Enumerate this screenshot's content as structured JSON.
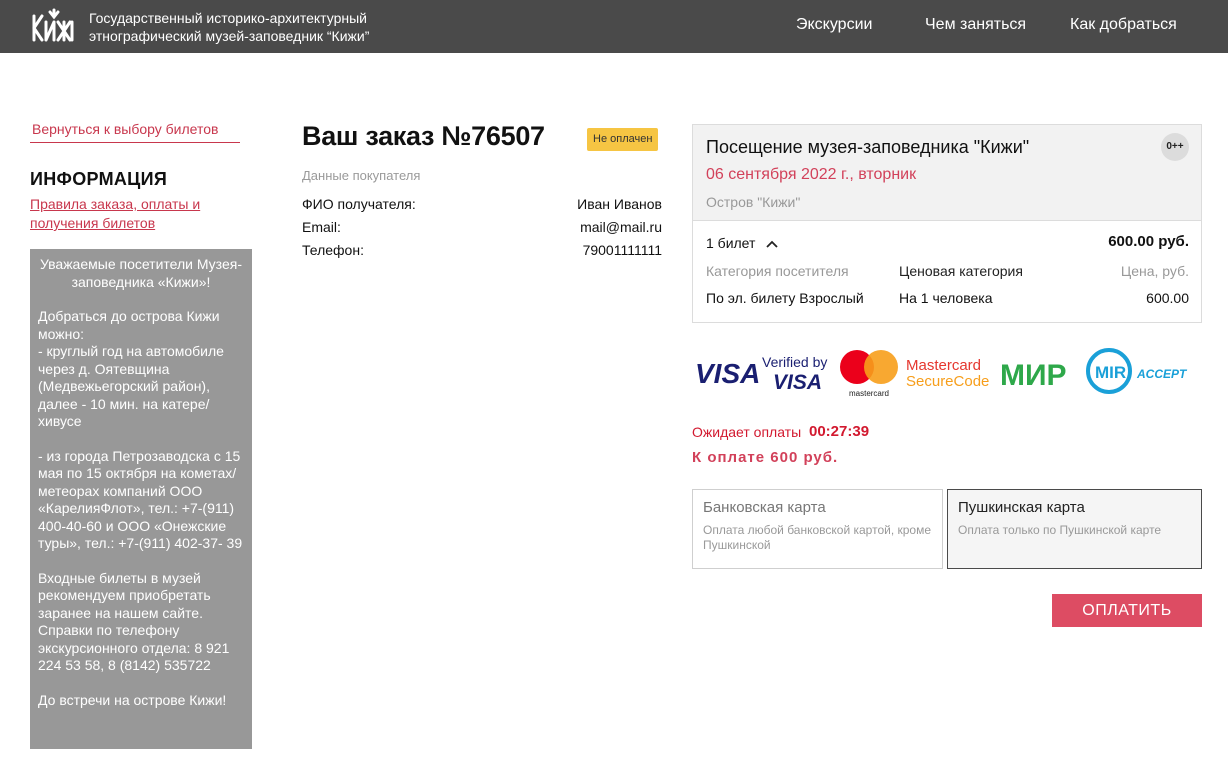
{
  "header": {
    "org_line1": "Государственный историко-архитектурный",
    "org_line2": "этнографический музей-заповедник “Кижи”",
    "nav": [
      "Экскурсии",
      "Чем заняться",
      "Как добраться"
    ]
  },
  "sidebar": {
    "back_link": "Вернуться к выбору билетов",
    "info_title": "ИНФОРМАЦИЯ",
    "rules_link": "Правила заказа, оплаты и получения билетов",
    "info_intro": "Уважаемые посетители Музея-заповедника «Кижи»!",
    "info_p1": "Добраться до острова Кижи можно:\n- круглый год на автомобиле через д. Оятевщина (Медвежьегорский район), далее - 10 мин. на катере/хивусе",
    "info_p2": "- из города Петрозаводска с 15 мая по 15 октября на кометах/метеорах компаний ООО «КарелияФлот», тел.: +7-(911) 400-40-60 и  ООО «Онежские туры», тел.: +7-(911) 402-37- 39",
    "info_p3": "Входные билеты в музей рекомендуем приобретать заранее на нашем сайте. Справки по телефону экскурсионного отдела: 8 921 224 53 58, 8 (8142) 535722",
    "info_p4": "До встречи на острове Кижи!"
  },
  "order": {
    "title": "Ваш заказ №76507",
    "status": "Не оплачен",
    "buyer_section": "Данные покупателя",
    "fields": [
      {
        "label": "ФИО получателя:",
        "value": "Иван Иванов"
      },
      {
        "label": "Email:",
        "value": "mail@mail.ru"
      },
      {
        "label": "Телефон:",
        "value": "79001111111"
      }
    ]
  },
  "summary": {
    "event": "Посещение музея-заповедника \"Кижи\"",
    "date": "06 сентября 2022 г., вторник",
    "place": "Остров \"Кижи\"",
    "age": "0++",
    "ticket_count": "1 билет",
    "ticket_total": "600.00 руб.",
    "headers": [
      "Категория посетителя",
      "Ценовая категория",
      "Цена, руб."
    ],
    "row": [
      "По эл. билету Взрослый",
      "На 1 человека",
      "600.00"
    ]
  },
  "payment_logos": {
    "visa": "VISA",
    "verified_line1": "Verified by",
    "verified_line2": "VISA",
    "mastercard": "mastercard",
    "securecode_line1": "Mastercard",
    "securecode_line2": "SecureCode",
    "mir": "МИР",
    "mir_accept": "ACCEPT"
  },
  "payment": {
    "await_label": "Ожидает оплаты",
    "timer": "00:27:39",
    "to_pay": "К оплате 600 руб.",
    "options": [
      {
        "title": "Банковская карта",
        "desc": "Оплата любой банковской картой, кроме Пушкинской"
      },
      {
        "title": "Пушкинская карта",
        "desc": "Оплата только по Пушкинской карте"
      }
    ],
    "pay_button": "ОПЛАТИТЬ"
  },
  "colors": {
    "header_bg": "#4a4a4a",
    "accent": "#dd4c63",
    "status_badge": "#f6c543",
    "info_box": "#989898"
  }
}
